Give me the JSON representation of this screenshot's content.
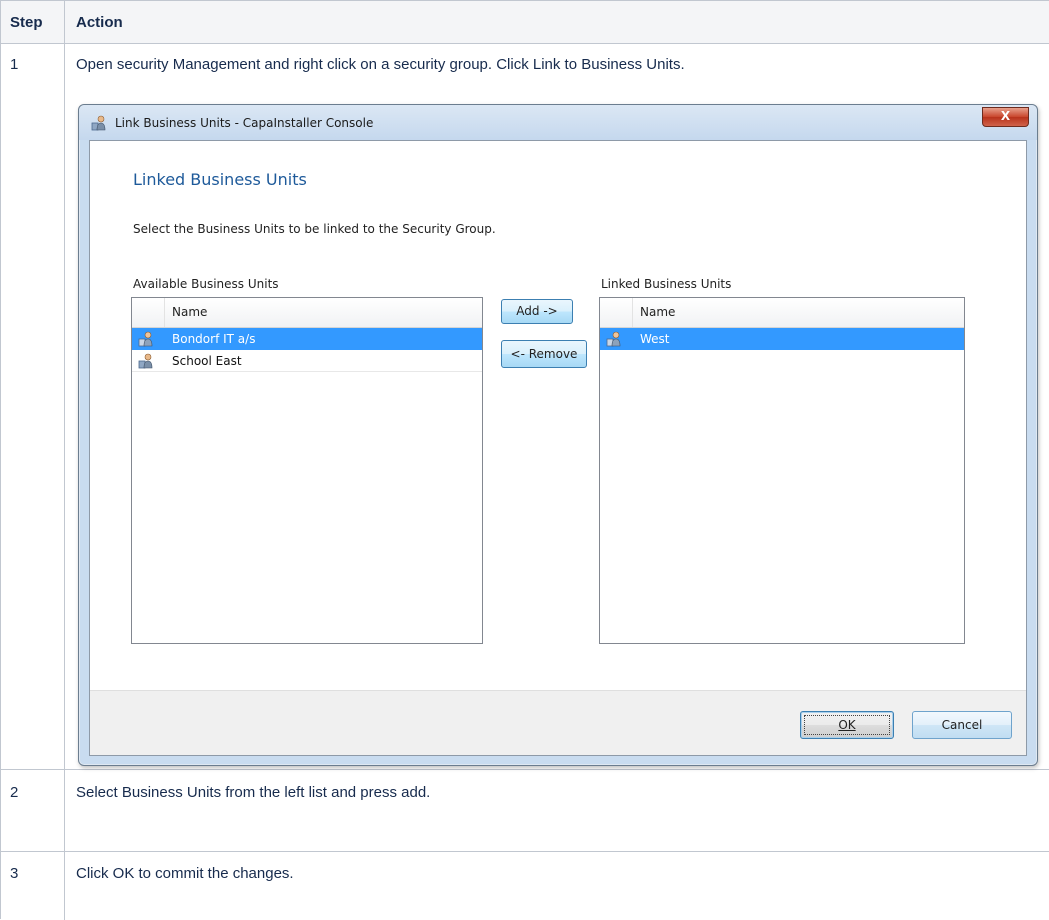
{
  "table": {
    "headers": {
      "step": "Step",
      "action": "Action"
    },
    "rows": [
      {
        "step": "1",
        "action": "Open security Management and right click on a security group. Click Link to Business Units."
      },
      {
        "step": "2",
        "action": "Select Business Units from the left list and press add."
      },
      {
        "step": "3",
        "action": "Click OK to commit the changes."
      }
    ]
  },
  "dialog": {
    "title": "Link Business Units - CapaInstaller Console",
    "close_label": "X",
    "heading": "Linked Business Units",
    "instruction": "Select the Business Units to be linked to the Security Group.",
    "available": {
      "label": "Available Business Units",
      "column": "Name",
      "items": [
        {
          "name": "Bondorf IT a/s",
          "selected": true
        },
        {
          "name": "School East",
          "selected": false
        }
      ]
    },
    "linked": {
      "label": "Linked Business Units",
      "column": "Name",
      "items": [
        {
          "name": "West",
          "selected": true
        }
      ]
    },
    "add_label": "Add ->",
    "remove_label": "<- Remove",
    "ok_label": "OK",
    "cancel_label": "Cancel"
  },
  "icons": {
    "title_icon": "business-unit-icon",
    "row_icon": "business-unit-icon"
  },
  "colors": {
    "selection": "#3399ff",
    "heading": "#1e5a9a",
    "close": "#c8452b"
  }
}
